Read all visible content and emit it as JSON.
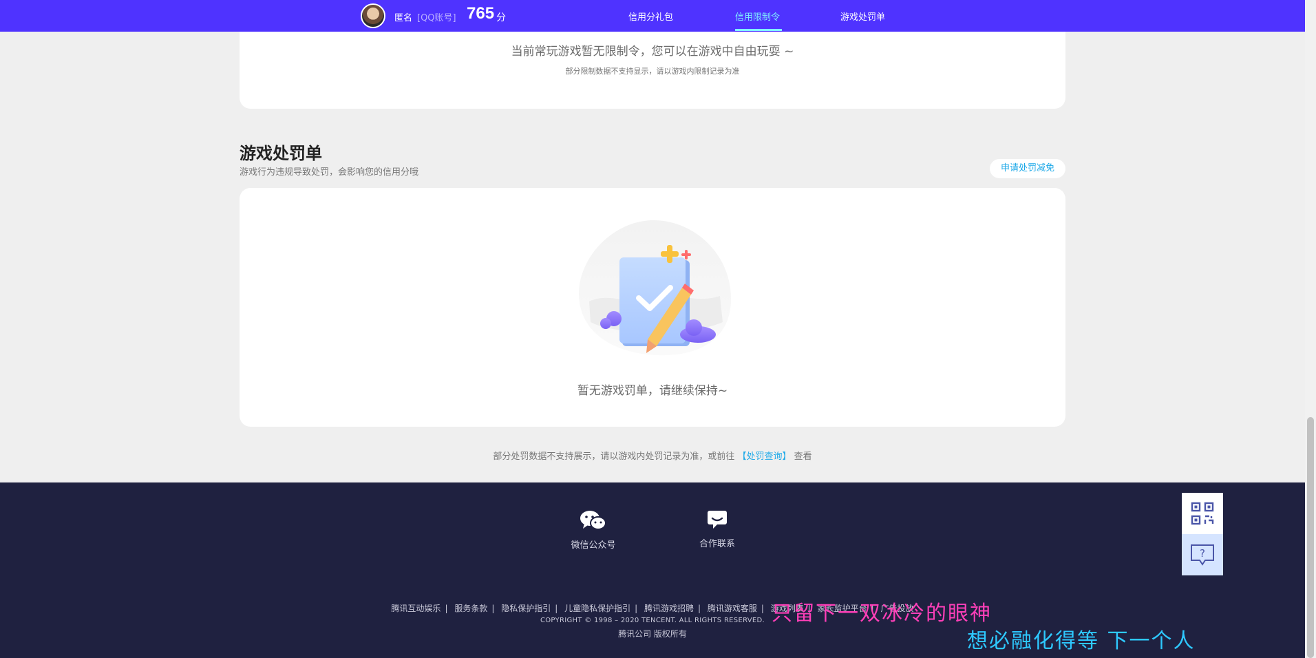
{
  "header": {
    "user_name": "匿名",
    "account_type": "[QQ账号]",
    "score": "765",
    "score_unit": "分",
    "nav": [
      "信用分礼包",
      "信用限制令",
      "游戏处罚单"
    ],
    "active_nav": "信用限制令"
  },
  "restriction": {
    "message": "当前常玩游戏暂无限制令，您可以在游戏中自由玩耍 ~",
    "note": "部分限制数据不支持显示，请以游戏内限制记录为准"
  },
  "penalty": {
    "title": "游戏处罚单",
    "description": "游戏行为违规导致处罚，会影响您的信用分哦",
    "apply_button": "申请处罚减免",
    "empty_message": "暂无游戏罚单，请继续保持~",
    "footnote_prefix": "部分处罚数据不支持展示，请以游戏内处罚记录为准，或前往",
    "footnote_link": "【处罚查询】",
    "footnote_suffix": "查看"
  },
  "footer": {
    "contacts": [
      "微信公众号",
      "合作联系"
    ],
    "links": [
      "腾讯互动娱乐",
      "服务条款",
      "隐私保护指引",
      "儿童隐私保护指引",
      "腾讯游戏招聘",
      "腾讯游戏客服",
      "游戏列表",
      "家长监护平台",
      "广告投放"
    ],
    "copyright": "COPYRIGHT © 1998 – 2020 TENCENT. ALL RIGHTS RESERVED.",
    "rights": "腾讯公司 版权所有"
  },
  "lyrics": {
    "line1": "只留下一双冰冷的眼神",
    "line2": "想必融化得等 下一个人"
  },
  "colors": {
    "nav_bg": "#4f33ff",
    "active_nav": "#7ff0ff",
    "link": "#1ea9e8",
    "footer_bg": "#1f2140"
  }
}
